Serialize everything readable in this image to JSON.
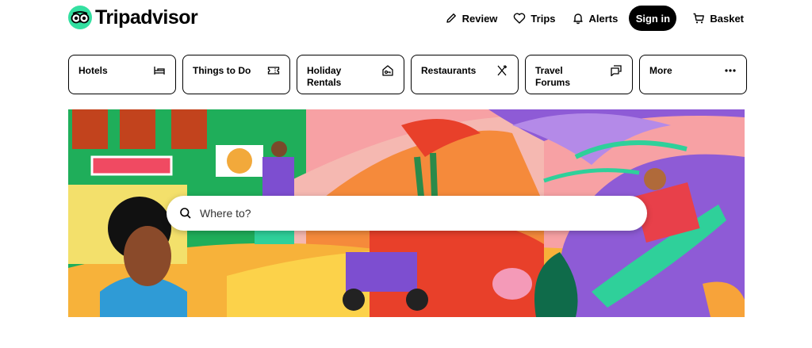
{
  "brand": {
    "name": "Tripadvisor",
    "logo_color": "#34e0a1"
  },
  "nav": {
    "review": "Review",
    "trips": "Trips",
    "alerts": "Alerts",
    "sign_in": "Sign in",
    "basket": "Basket"
  },
  "categories": [
    {
      "label": "Hotels",
      "icon": "bed-icon"
    },
    {
      "label": "Things to Do",
      "icon": "ticket-icon"
    },
    {
      "label": "Holiday Rentals",
      "icon": "house-key-icon"
    },
    {
      "label": "Restaurants",
      "icon": "utensils-icon"
    },
    {
      "label": "Travel Forums",
      "icon": "chat-bubbles-icon"
    },
    {
      "label": "More",
      "icon": "more-dots-icon"
    }
  ],
  "search": {
    "placeholder": "Where to?"
  }
}
